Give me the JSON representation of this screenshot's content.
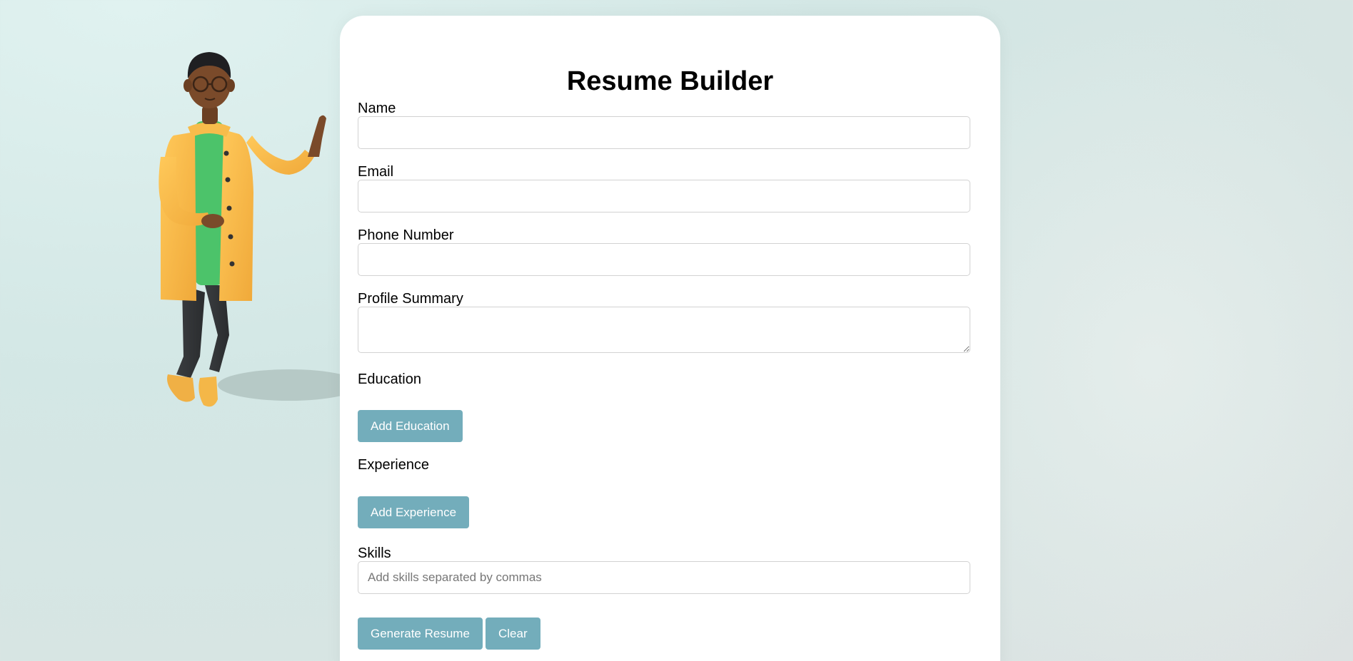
{
  "page": {
    "title": "Resume Builder"
  },
  "form": {
    "name": {
      "label": "Name",
      "value": "",
      "placeholder": ""
    },
    "email": {
      "label": "Email",
      "value": "",
      "placeholder": ""
    },
    "phone": {
      "label": "Phone Number",
      "value": "",
      "placeholder": ""
    },
    "summary": {
      "label": "Profile Summary",
      "value": "",
      "placeholder": ""
    },
    "education": {
      "label": "Education",
      "add_button": "Add Education"
    },
    "experience": {
      "label": "Experience",
      "add_button": "Add Experience"
    },
    "skills": {
      "label": "Skills",
      "value": "",
      "placeholder": "Add skills separated by commas"
    }
  },
  "actions": {
    "generate": "Generate Resume",
    "clear": "Clear"
  },
  "colors": {
    "button": "#73adbb",
    "card": "#ffffff",
    "background": "#d3e7e5"
  },
  "illustration": {
    "icon": "3d-man-character-waving"
  }
}
